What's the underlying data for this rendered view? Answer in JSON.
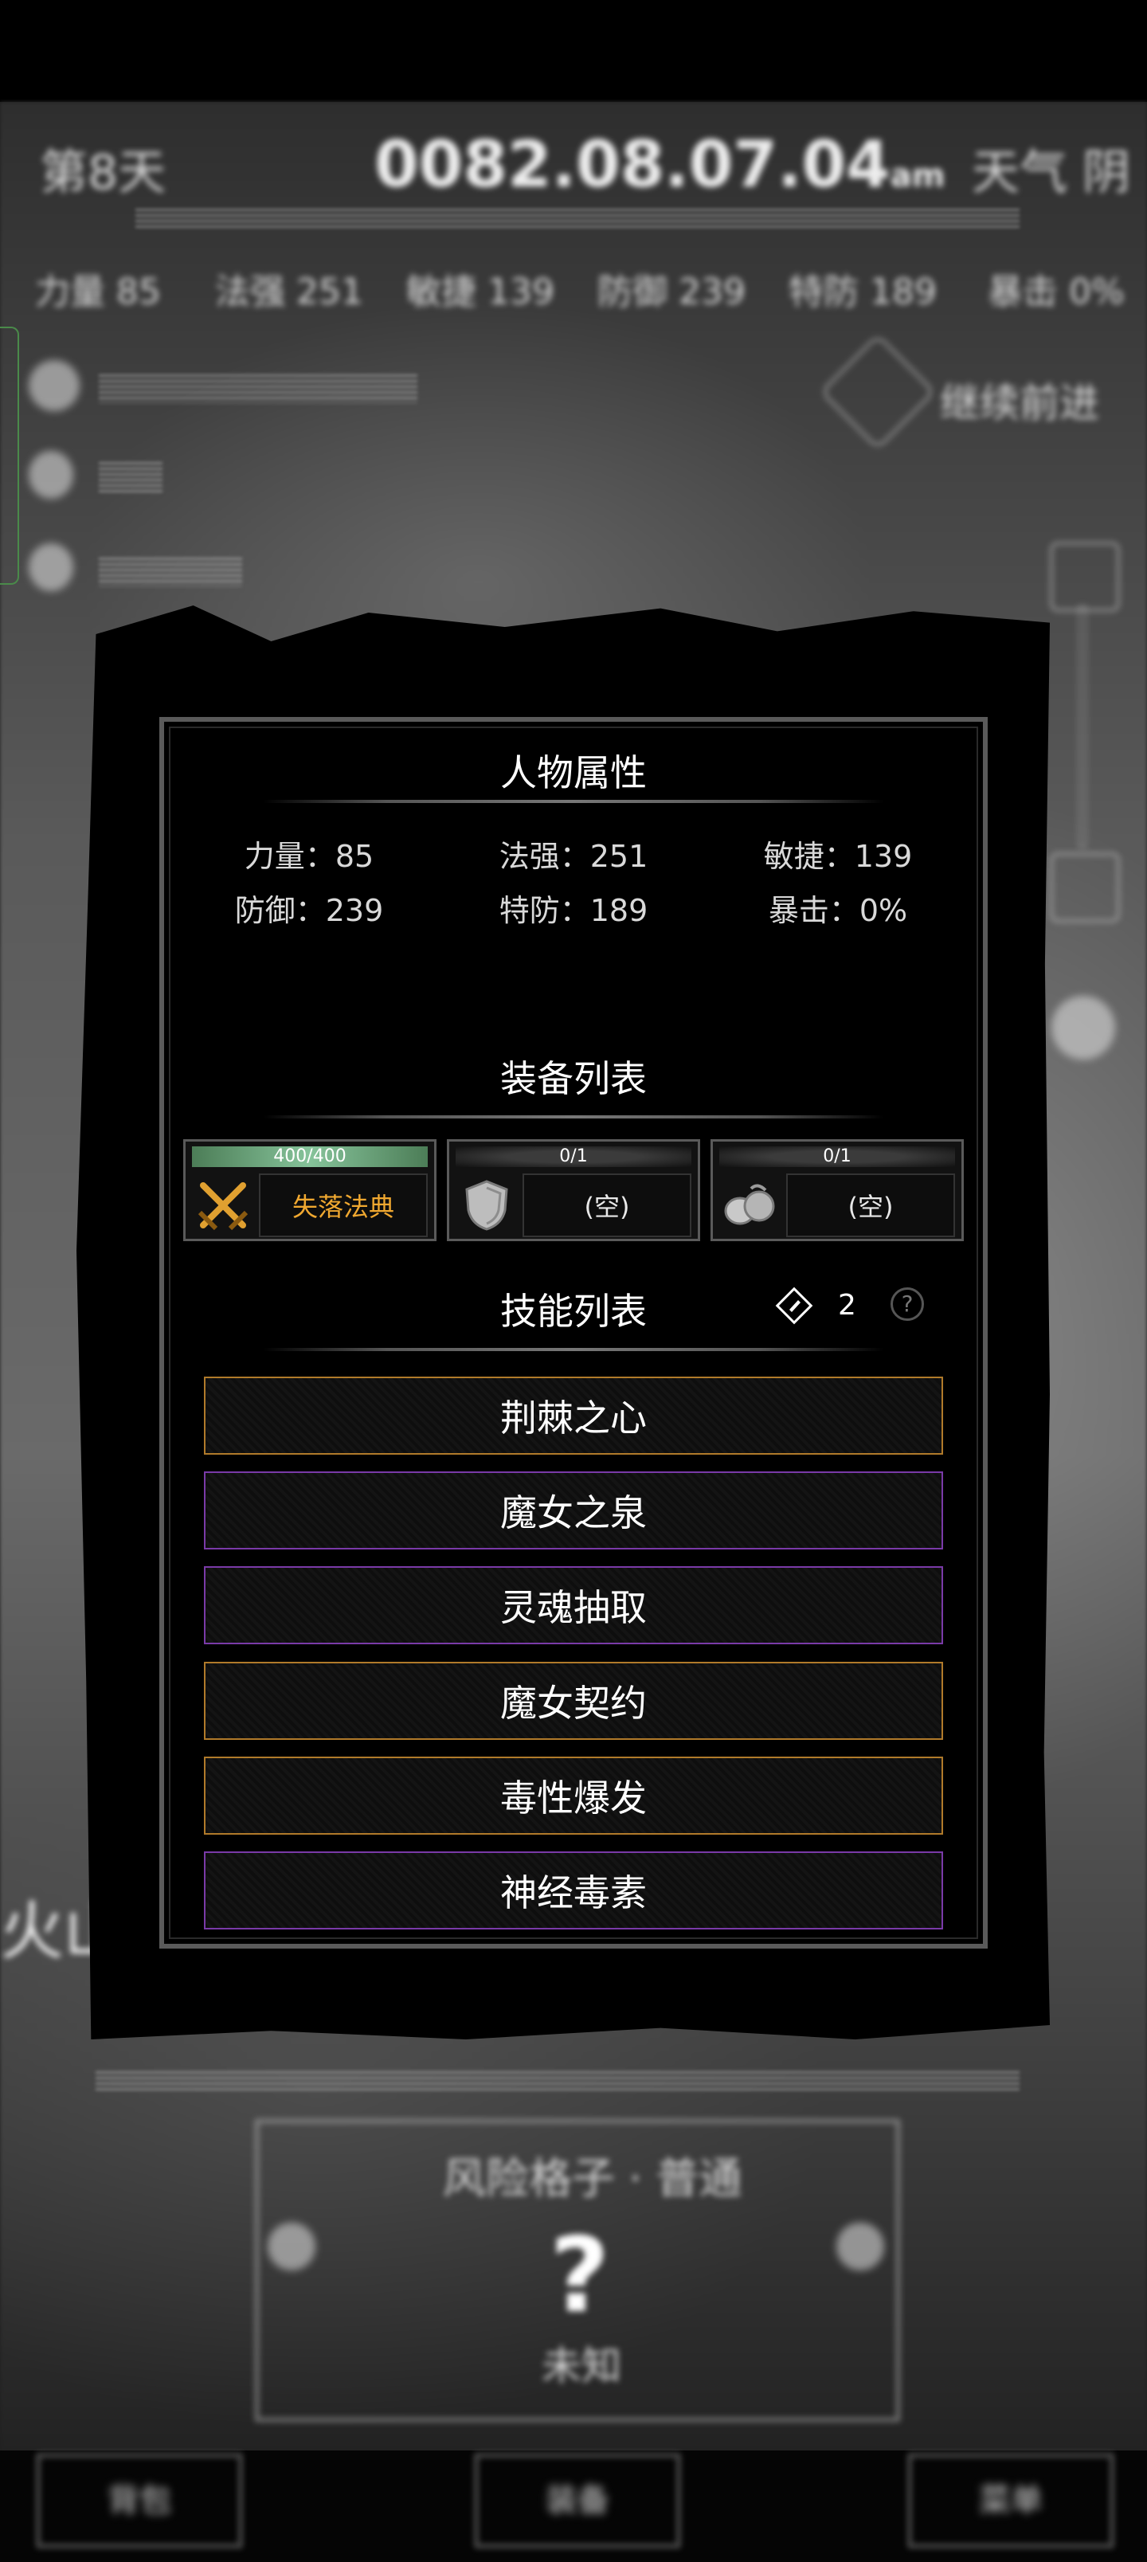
{
  "background": {
    "day_label": "第8天",
    "clock": "0082.08.07.04",
    "clock_suffix": "am",
    "weather": "天气 阴",
    "stats_line": [
      "力量 85",
      "法强 251",
      "敏捷 139",
      "防御 239",
      "特防 189",
      "暴击 0%"
    ],
    "side_button": "继续前进",
    "region_label": "火山",
    "encounter_title": "风险格子 · 普通",
    "encounter_mark": "?",
    "encounter_sub": "未知",
    "bottom_buttons": [
      "背包",
      "装备",
      "菜单"
    ]
  },
  "panel": {
    "attributes_title": "人物属性",
    "stats": [
      {
        "label": "力量",
        "value": "85"
      },
      {
        "label": "法强",
        "value": "251"
      },
      {
        "label": "敏捷",
        "value": "139"
      },
      {
        "label": "防御",
        "value": "239"
      },
      {
        "label": "特防",
        "value": "189"
      },
      {
        "label": "暴击",
        "value": "0%"
      }
    ],
    "equipment_title": "装备列表",
    "equipment": [
      {
        "durability": "400/400",
        "name": "失落法典",
        "icon": "crossed-swords-icon",
        "color": "#f0a830"
      },
      {
        "durability": "0/1",
        "name": "(空)",
        "icon": "shield-icon"
      },
      {
        "durability": "0/1",
        "name": "(空)",
        "icon": "armor-icon"
      }
    ],
    "skills_title": "技能列表",
    "skill_points": "2",
    "help": "?",
    "skills": [
      {
        "name": "荆棘之心",
        "rarity_color": "#b07a2a"
      },
      {
        "name": "魔女之泉",
        "rarity_color": "#7a3aa8"
      },
      {
        "name": "灵魂抽取",
        "rarity_color": "#7a3aa8"
      },
      {
        "name": "魔女契约",
        "rarity_color": "#b07a2a"
      },
      {
        "name": "毒性爆发",
        "rarity_color": "#b07a2a"
      },
      {
        "name": "神经毒素",
        "rarity_color": "#7a3aa8"
      }
    ]
  }
}
